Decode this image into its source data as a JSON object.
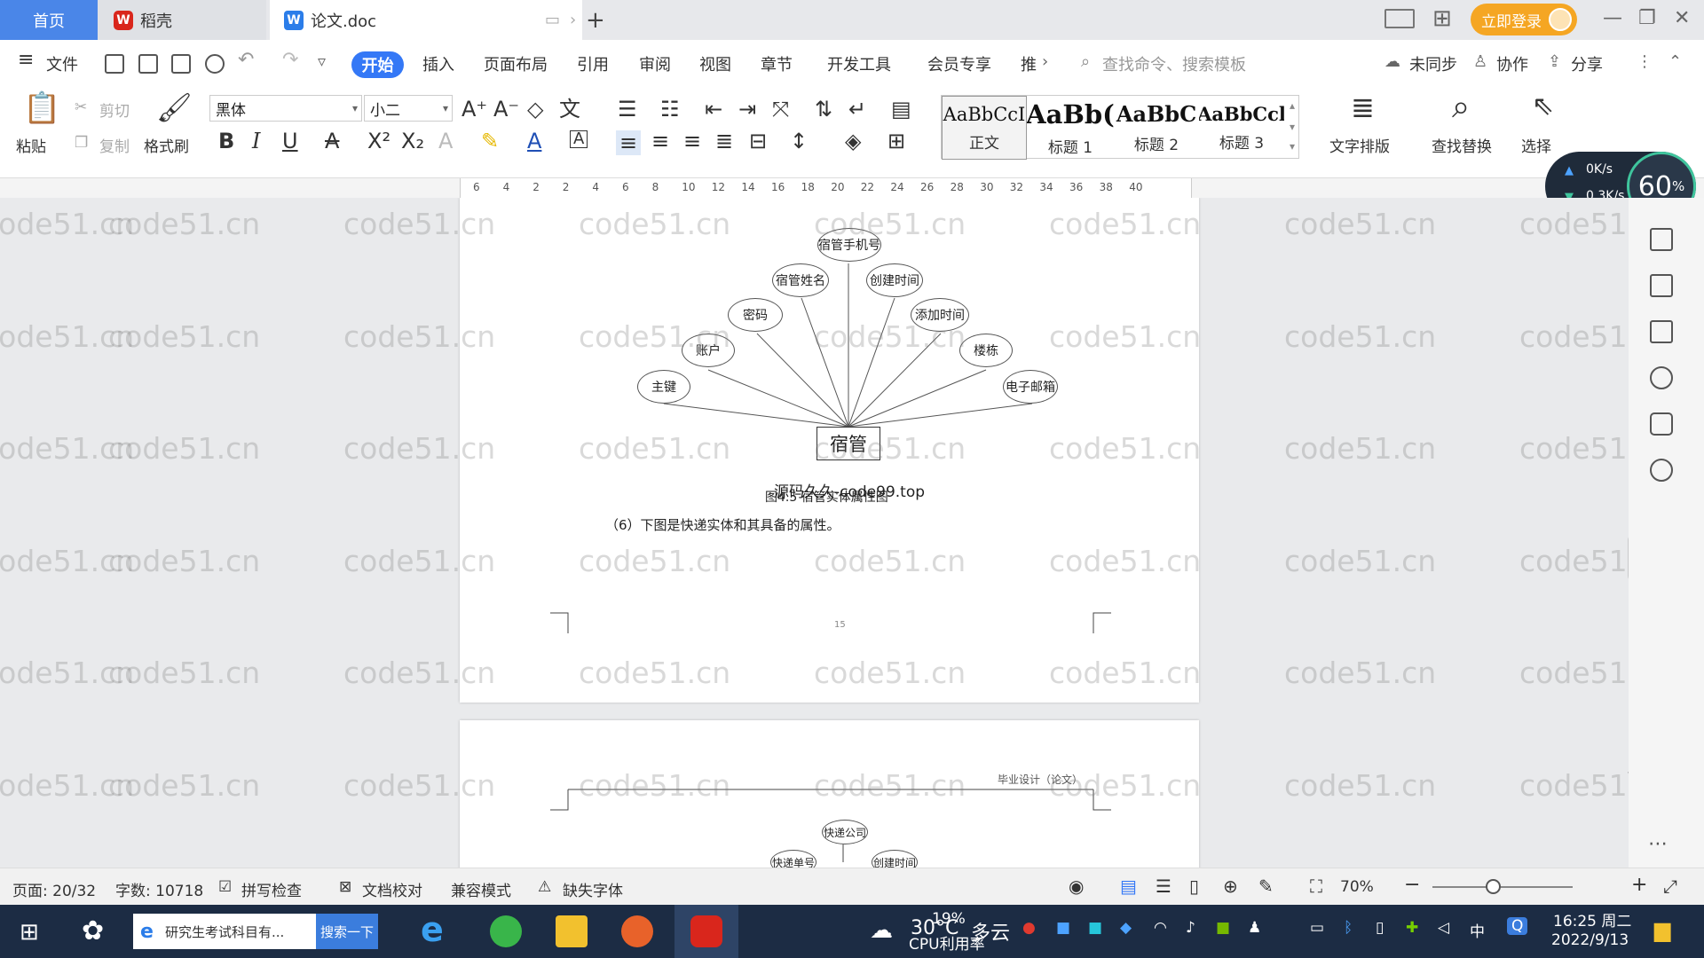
{
  "tabs": {
    "home": "首页",
    "wps": "稻壳",
    "doc": "论文.doc",
    "login": "立即登录"
  },
  "menu": {
    "file": "文件",
    "items": [
      "开始",
      "插入",
      "页面布局",
      "引用",
      "审阅",
      "视图",
      "章节",
      "开发工具",
      "会员专享",
      "推"
    ],
    "search_cmd": "查找命令、搜索模板",
    "unsynced": "未同步",
    "collab": "协作",
    "share": "分享"
  },
  "toolbar": {
    "paste": "粘贴",
    "cut": "剪切",
    "copy": "复制",
    "format_painter": "格式刷",
    "font_name": "黑体",
    "font_size": "小二",
    "styles": [
      {
        "preview": "AaBbCcI",
        "name": "正文"
      },
      {
        "preview": "AaBb(",
        "name": "标题 1"
      },
      {
        "preview": "AaBbC",
        "name": "标题 2"
      },
      {
        "preview": "AaBbCcl",
        "name": "标题 3"
      }
    ],
    "text_layout": "文字排版",
    "find_replace": "查找替换",
    "select": "选择"
  },
  "ruler_ticks": [
    "6",
    "4",
    "2",
    "2",
    "4",
    "6",
    "8",
    "10",
    "12",
    "14",
    "16",
    "18",
    "20",
    "22",
    "24",
    "26",
    "28",
    "30",
    "32",
    "34",
    "36",
    "38",
    "40"
  ],
  "netspeed": {
    "up": "0K/s",
    "down": "0.3K/s",
    "percent": "60",
    "unit": "%"
  },
  "document": {
    "watermark": "code51.cn",
    "diagram1": {
      "entity": "宿管",
      "attributes": [
        "主键",
        "账户",
        "密码",
        "宿管姓名",
        "宿管手机号",
        "创建时间",
        "添加时间",
        "楼栋",
        "电子邮箱"
      ]
    },
    "overlay_text": "源码久久-code99.top",
    "caption": "图4.5 宿管实体属性图",
    "paragraph": "（6）下图是快递实体和其具备的属性。",
    "page_number": "15",
    "header_text": "毕业设计（论文）",
    "diagram2": {
      "attributes": [
        "快递公司",
        "快递单号",
        "创建时间"
      ]
    }
  },
  "statusbar": {
    "page": "页面: 20/32",
    "words": "字数: 10718",
    "spell": "拼写检查",
    "proof": "文档校对",
    "compat": "兼容模式",
    "missing_font": "缺失字体",
    "zoom": "70%"
  },
  "taskbar": {
    "search_text": "研究生考试科目有...",
    "search_btn": "搜索一下",
    "weather_temp": "30°C",
    "weather_desc": "多云",
    "cpu_percent": "19%",
    "cpu_label": "CPU利用率",
    "ime": "中",
    "time": "16:25 周二",
    "date": "2022/9/13"
  }
}
